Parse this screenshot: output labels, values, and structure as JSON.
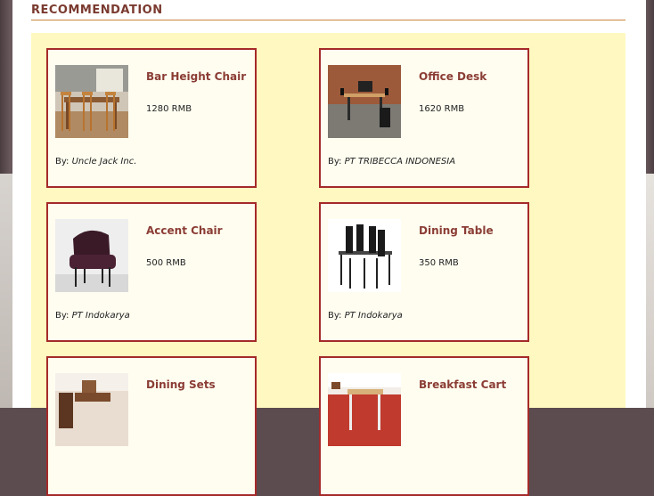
{
  "section": {
    "title": "RECOMMENDATION"
  },
  "by_label": "By:",
  "products": [
    {
      "name": "Bar Height Chair",
      "price": "1280 RMB",
      "seller": "Uncle Jack Inc.",
      "image": "bar-height-chair-photo"
    },
    {
      "name": "Office Desk",
      "price": "1620 RMB",
      "seller": "PT TRIBECCA INDONESIA",
      "image": "office-desk-photo"
    },
    {
      "name": "Accent Chair",
      "price": "500 RMB",
      "seller": "PT Indokarya",
      "image": "accent-chair-photo"
    },
    {
      "name": "Dining Table",
      "price": "350 RMB",
      "seller": "PT Indokarya",
      "image": "dining-table-photo"
    },
    {
      "name": "Dining Sets",
      "price": "",
      "seller": "",
      "image": "dining-sets-photo"
    },
    {
      "name": "Breakfast Cart",
      "price": "",
      "seller": "",
      "image": "breakfast-cart-photo"
    }
  ],
  "colors": {
    "accent": "#8b3d35",
    "card_border": "#a52a2a",
    "grid_bg": "#fff8c0",
    "rule": "#c9843a"
  }
}
